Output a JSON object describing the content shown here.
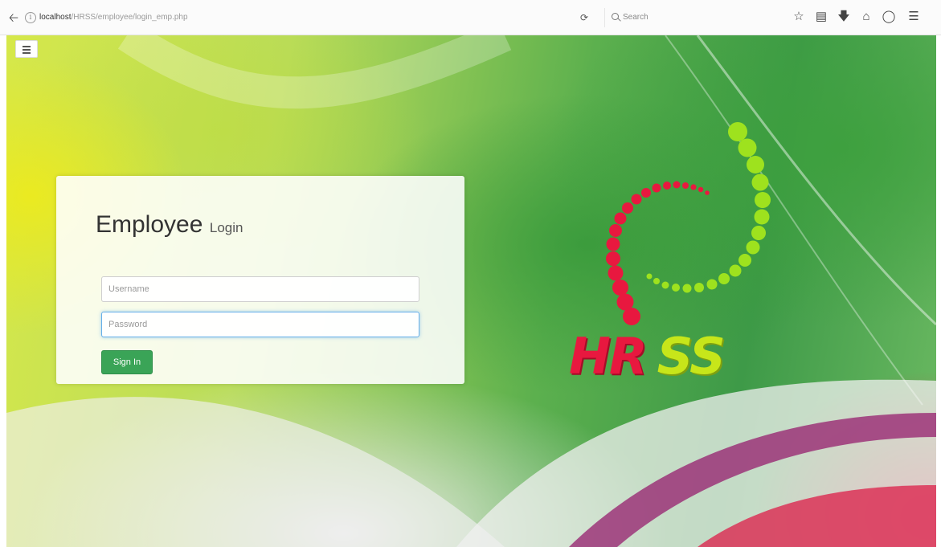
{
  "browser": {
    "url_host": "localhost",
    "url_path": "/HRSS/employee/login_emp.php",
    "search_placeholder": "Search"
  },
  "login": {
    "title": "Employee",
    "subtitle": "Login",
    "username_placeholder": "Username",
    "password_placeholder": "Password",
    "signin_label": "Sign In"
  },
  "logo": {
    "text_hr": "HR",
    "text_ss": "SS"
  },
  "colors": {
    "signin_button": "#3aa457",
    "logo_red": "#e8183f",
    "logo_green": "#c7e61a"
  }
}
